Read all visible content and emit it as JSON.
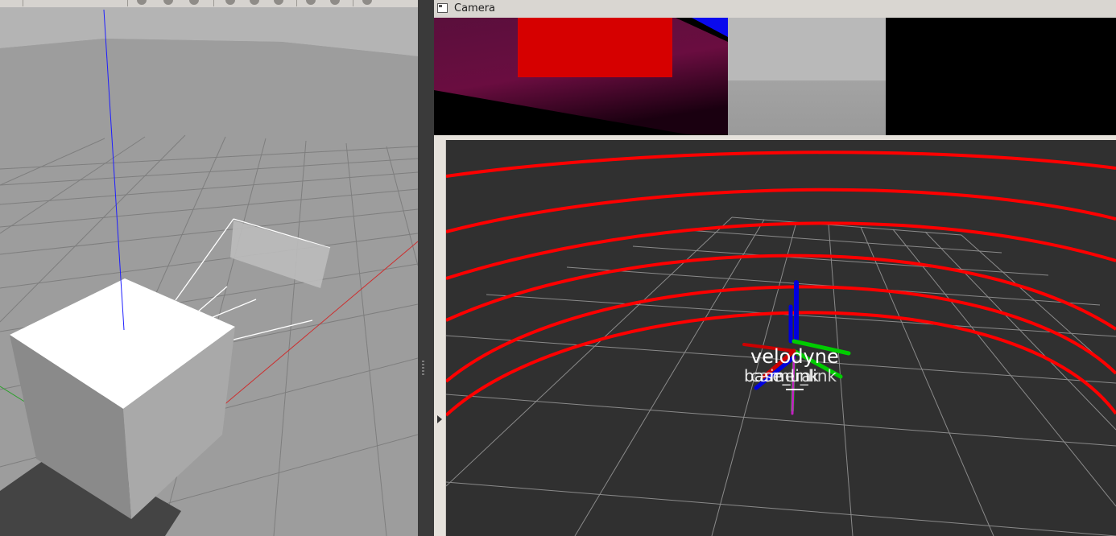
{
  "camera_panel": {
    "title": "Camera"
  },
  "rviz_view": {
    "frame_labels": {
      "velodyne": "velodyne",
      "base_link": "base_link",
      "camera": "camera",
      "imu_link": "imu_link"
    }
  },
  "colors": {
    "gazebo_background": "#9c9c9c",
    "rviz_background": "#303030",
    "laser_scan": "#ff0000",
    "axis_x": "#ff0000",
    "axis_y": "#00ff00",
    "axis_z": "#0000ff"
  }
}
